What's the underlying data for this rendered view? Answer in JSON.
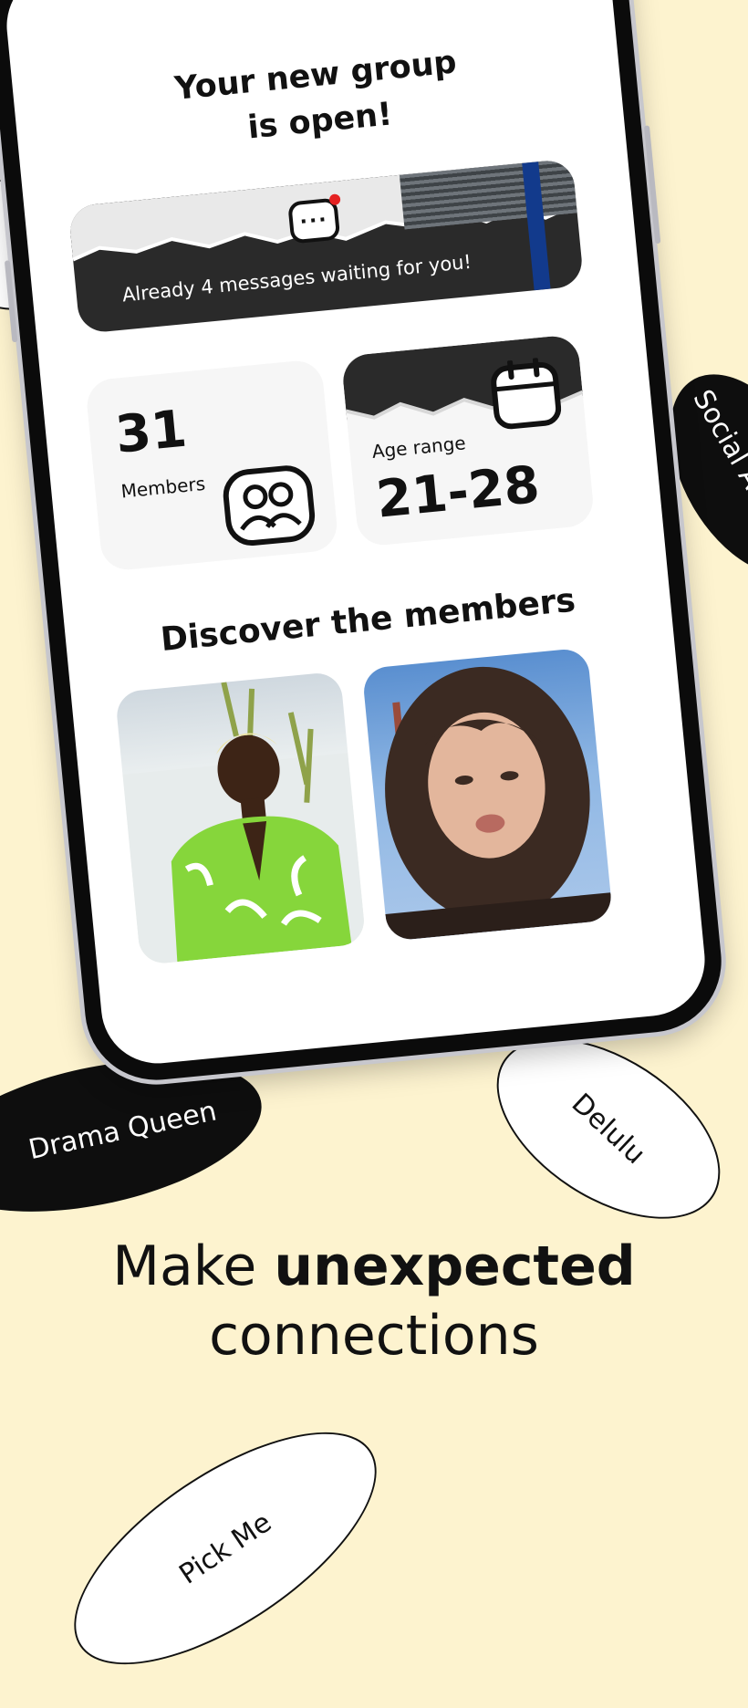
{
  "phone": {
    "title_line1": "Your new group",
    "title_line2": "is open!",
    "message_banner": "Already 4 messages waiting for you!",
    "members": {
      "count": "31",
      "label": "Members"
    },
    "age": {
      "label": "Age range",
      "value": "21-28"
    },
    "section_title": "Discover the members"
  },
  "tags": {
    "drama_queen": "Drama Queen",
    "delulu": "Delulu",
    "pick_me": "Pick Me",
    "social_add": "Social Add"
  },
  "headline": {
    "line1_regular": "Make ",
    "line1_bold": "unexpected",
    "line2": "connections"
  },
  "colors": {
    "background": "#fdf3cf",
    "card_dark": "#2a2a2a",
    "notification_dot": "#e52222"
  }
}
